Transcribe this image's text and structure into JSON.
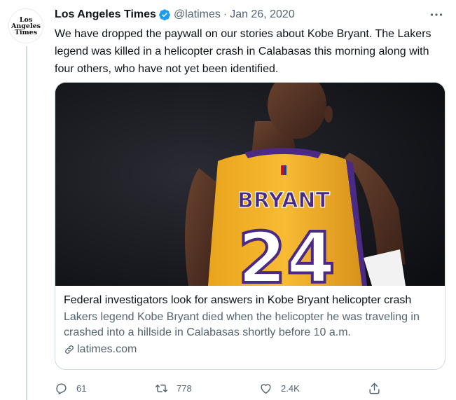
{
  "account": {
    "name": "Los Angeles Times",
    "handle": "@latimes",
    "separator": "·",
    "date": "Jan 26, 2020",
    "avatar_line1": "Los",
    "avatar_line2": "Angeles",
    "avatar_line3": "Times"
  },
  "tweet": {
    "text": "We have dropped the paywall on our stories about Kobe Bryant. The Lakers legend was killed in a helicopter crash in Calabasas this morning along with four others, who have not yet been identified."
  },
  "card": {
    "jersey_name": "BRYANT",
    "jersey_number": "24",
    "title": "Federal investigators look for answers in Kobe Bryant helicopter crash",
    "description": "Lakers legend Kobe Bryant died when the helicopter he was traveling in crashed into a hillside in Calabasas shortly before 10 a.m.",
    "domain": "latimes.com"
  },
  "actions": {
    "replies": "61",
    "retweets": "778",
    "likes": "2.4K"
  },
  "icons": {
    "verified": "verified-badge-icon",
    "more": "more-icon",
    "link": "link-icon",
    "reply": "reply-icon",
    "retweet": "retweet-icon",
    "like": "heart-icon",
    "share": "share-icon"
  },
  "colors": {
    "accent": "#1d9bf0",
    "text": "#0f1419",
    "secondary": "#536471",
    "border": "#cfd9de",
    "jersey_gold": "#f6b52a",
    "jersey_purple": "#4b2a86"
  }
}
